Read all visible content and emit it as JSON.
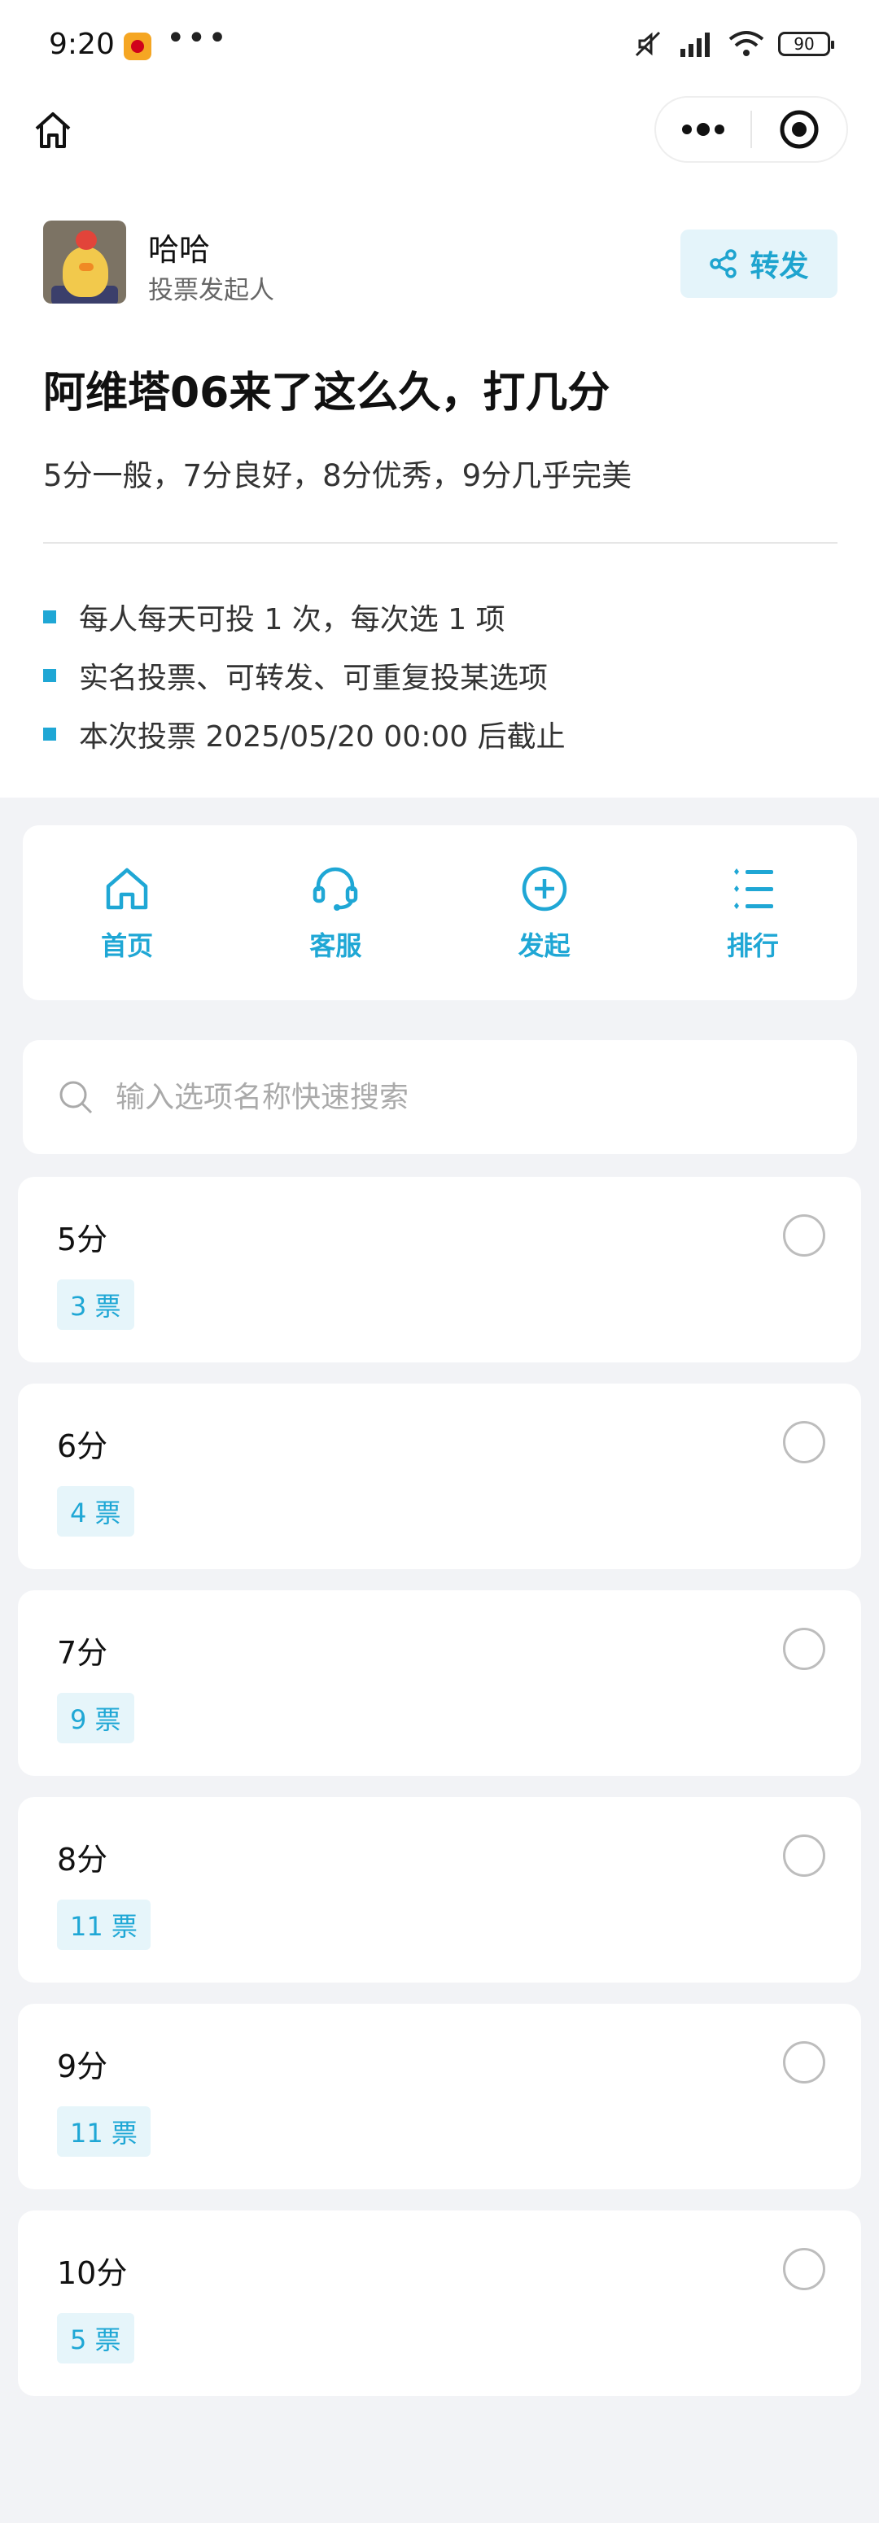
{
  "status_bar": {
    "time": "9:20",
    "dots": "•••",
    "battery": "90"
  },
  "header": {
    "home_icon": "home-outline-icon",
    "menu_icon": "more-dots-icon",
    "close_icon": "target-icon"
  },
  "creator": {
    "name": "哈哈",
    "role": "投票发起人"
  },
  "share_label": "转发",
  "poll": {
    "title": "阿维塔06来了这么久，打几分",
    "subtitle": "5分一般，7分良好，8分优秀，9分几乎完美",
    "rules": [
      "每人每天可投 1 次，每次选 1 项",
      "实名投票、可转发、可重复投某选项",
      "本次投票 2025/05/20 00:00 后截止"
    ]
  },
  "quick_nav": [
    {
      "label": "首页",
      "icon": "home-icon"
    },
    {
      "label": "客服",
      "icon": "headset-icon"
    },
    {
      "label": "发起",
      "icon": "plus-circle-icon"
    },
    {
      "label": "排行",
      "icon": "ranking-list-icon"
    }
  ],
  "search": {
    "placeholder": "输入选项名称快速搜索"
  },
  "options": [
    {
      "label": "5分",
      "votes": "3 票"
    },
    {
      "label": "6分",
      "votes": "4 票"
    },
    {
      "label": "7分",
      "votes": "9 票"
    },
    {
      "label": "8分",
      "votes": "11 票"
    },
    {
      "label": "9分",
      "votes": "11 票"
    },
    {
      "label": "10分",
      "votes": "5 票"
    }
  ],
  "colors": {
    "accent": "#1fa7d5",
    "background": "#f2f3f6",
    "vote_badge_bg": "#e6f5fa"
  }
}
